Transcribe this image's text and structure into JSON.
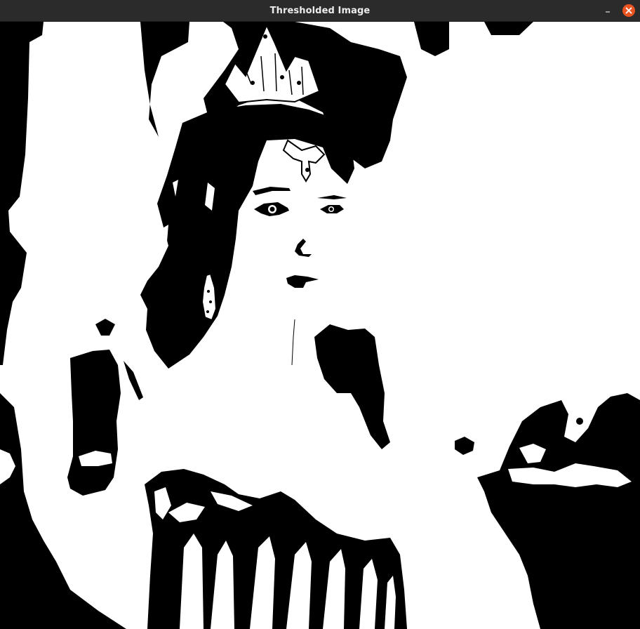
{
  "window": {
    "title": "Thresholded Image",
    "close_color": "#e95420",
    "titlebar_color": "#2b2b2b"
  },
  "controls": {
    "minimize_icon": "minimize-icon",
    "close_icon": "close-icon"
  },
  "image": {
    "mode": "binary-threshold",
    "colors": [
      "#000000",
      "#ffffff"
    ],
    "subject": "woman-with-tiara-portrait"
  }
}
